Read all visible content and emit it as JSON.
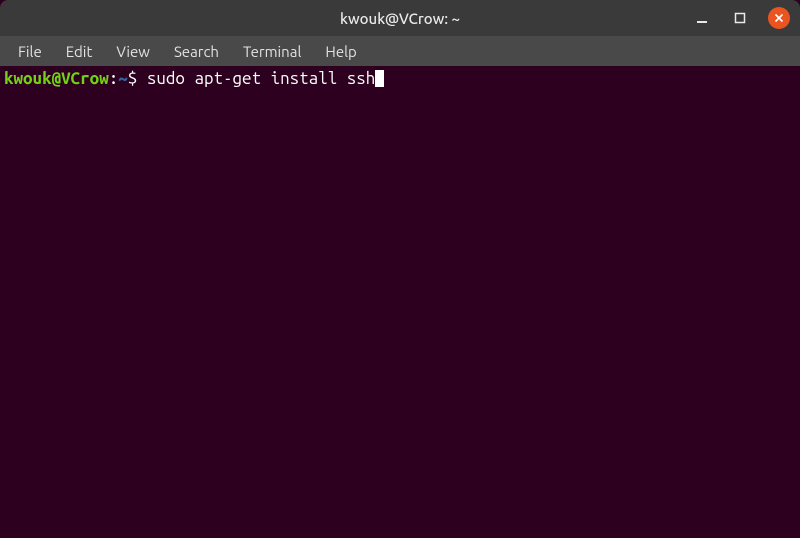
{
  "titlebar": {
    "title": "kwouk@VCrow: ~"
  },
  "menubar": {
    "items": [
      "File",
      "Edit",
      "View",
      "Search",
      "Terminal",
      "Help"
    ]
  },
  "prompt": {
    "userhost": "kwouk@VCrow",
    "colon": ":",
    "path": "~",
    "symbol": "$ "
  },
  "command": "sudo apt-get install ssh"
}
